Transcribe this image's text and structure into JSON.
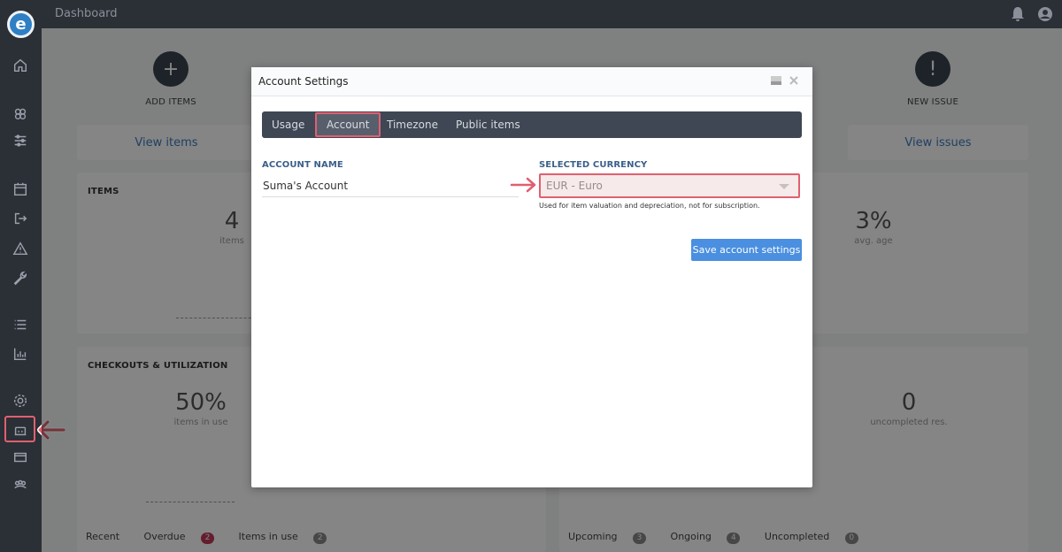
{
  "topbar": {
    "title": "Dashboard"
  },
  "dashboard": {
    "actions": [
      {
        "label": "ADD ITEMS",
        "icon": "plus-icon"
      },
      {
        "label": "NEW ISSUE",
        "icon": "warning-icon"
      }
    ],
    "view_buttons": [
      "View items",
      "View issues"
    ],
    "items_card": {
      "title": "ITEMS",
      "value": "4",
      "sub": "items"
    },
    "age_card": {
      "value": "3%",
      "sub": "avg. age"
    },
    "checkouts_card": {
      "title": "CHECKOUTS & UTILIZATION",
      "value": "50%",
      "sub": "items in use"
    },
    "reservations_card": {
      "value": "0",
      "sub": "uncompleted res."
    },
    "bottom_tabs_left": [
      {
        "label": "Recent",
        "count": ""
      },
      {
        "label": "Overdue",
        "count": "2"
      },
      {
        "label": "Items in use",
        "count": "2"
      }
    ],
    "bottom_tabs_right": [
      {
        "label": "Upcoming",
        "count": "3"
      },
      {
        "label": "Ongoing",
        "count": "4"
      },
      {
        "label": "Uncompleted",
        "count": "0"
      }
    ]
  },
  "modal": {
    "title": "Account Settings",
    "tabs": [
      "Usage",
      "Account",
      "Timezone",
      "Public items"
    ],
    "active_tab": "Account",
    "account_name_label": "ACCOUNT NAME",
    "account_name_value": "Suma's Account",
    "currency_label": "SELECTED CURRENCY",
    "currency_value": "EUR - Euro",
    "currency_helper": "Used for item valuation and depreciation, not for subscription.",
    "save_label": "Save account settings"
  },
  "colors": {
    "highlight": "#e06070",
    "primary": "#4a8fe0",
    "sidebar": "#2b2f36"
  }
}
